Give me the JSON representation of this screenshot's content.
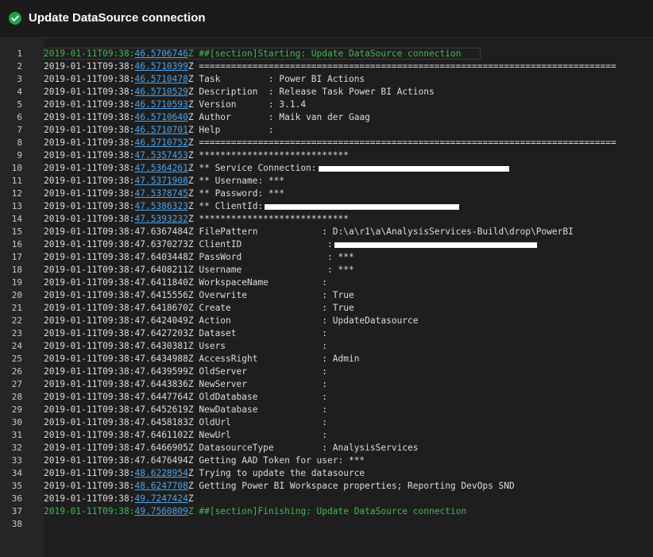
{
  "header": {
    "title": "Update DataSource connection",
    "status_icon": "check-circle-icon",
    "status_color": "#1ea446"
  },
  "log": {
    "lines": [
      {
        "n": "1",
        "date": "2019-01-11T09:38:",
        "sec": "46.5706746",
        "z": "Z",
        "msg": " ##[section]Starting: Update DataSource connection",
        "link": true,
        "section": true
      },
      {
        "n": "2",
        "date": "2019-01-11T09:38:",
        "sec": "46.5710399",
        "z": "Z",
        "msg": " ==============================================================================",
        "link": true
      },
      {
        "n": "3",
        "date": "2019-01-11T09:38:",
        "sec": "46.5710478",
        "z": "Z",
        "msg": " Task         : Power BI Actions",
        "link": true
      },
      {
        "n": "4",
        "date": "2019-01-11T09:38:",
        "sec": "46.5710529",
        "z": "Z",
        "msg": " Description  : Release Task Power BI Actions",
        "link": true
      },
      {
        "n": "5",
        "date": "2019-01-11T09:38:",
        "sec": "46.5710593",
        "z": "Z",
        "msg": " Version      : 3.1.4",
        "link": true
      },
      {
        "n": "6",
        "date": "2019-01-11T09:38:",
        "sec": "46.5710640",
        "z": "Z",
        "msg": " Author       : Maik van der Gaag",
        "link": true
      },
      {
        "n": "7",
        "date": "2019-01-11T09:38:",
        "sec": "46.5710701",
        "z": "Z",
        "msg": " Help         :",
        "link": true
      },
      {
        "n": "8",
        "date": "2019-01-11T09:38:",
        "sec": "46.5710752",
        "z": "Z",
        "msg": " ==============================================================================",
        "link": true
      },
      {
        "n": "9",
        "date": "2019-01-11T09:38:",
        "sec": "47.5357453",
        "z": "Z",
        "msg": " ****************************",
        "link": true
      },
      {
        "n": "10",
        "date": "2019-01-11T09:38:",
        "sec": "47.5364261",
        "z": "Z",
        "msg": " ** Service Connection:",
        "link": true,
        "redact": 240
      },
      {
        "n": "11",
        "date": "2019-01-11T09:38:",
        "sec": "47.5371908",
        "z": "Z",
        "msg": " ** Username: ***",
        "link": true
      },
      {
        "n": "12",
        "date": "2019-01-11T09:38:",
        "sec": "47.5378745",
        "z": "Z",
        "msg": " ** Password: ***",
        "link": true
      },
      {
        "n": "13",
        "date": "2019-01-11T09:38:",
        "sec": "47.5386323",
        "z": "Z",
        "msg": " ** ClientId:",
        "link": true,
        "redact": 245
      },
      {
        "n": "14",
        "date": "2019-01-11T09:38:",
        "sec": "47.5393232",
        "z": "Z",
        "msg": " ****************************",
        "link": true
      },
      {
        "n": "15",
        "date": "2019-01-11T09:38:",
        "sec": "47.6367484",
        "z": "Z",
        "msg": " FilePattern            : D:\\a\\r1\\a\\AnalysisServices-Build\\drop\\PowerBI",
        "link": false
      },
      {
        "n": "16",
        "date": "2019-01-11T09:38:",
        "sec": "47.6370273",
        "z": "Z",
        "msg": " ClientID                :",
        "link": false,
        "redact": 255
      },
      {
        "n": "17",
        "date": "2019-01-11T09:38:",
        "sec": "47.6403448",
        "z": "Z",
        "msg": " PassWord                : ***",
        "link": false
      },
      {
        "n": "18",
        "date": "2019-01-11T09:38:",
        "sec": "47.6408211",
        "z": "Z",
        "msg": " Username                : ***",
        "link": false
      },
      {
        "n": "19",
        "date": "2019-01-11T09:38:",
        "sec": "47.6411840",
        "z": "Z",
        "msg": " WorkspaceName          :",
        "link": false
      },
      {
        "n": "20",
        "date": "2019-01-11T09:38:",
        "sec": "47.6415556",
        "z": "Z",
        "msg": " Overwrite              : True",
        "link": false
      },
      {
        "n": "21",
        "date": "2019-01-11T09:38:",
        "sec": "47.6418670",
        "z": "Z",
        "msg": " Create                 : True",
        "link": false
      },
      {
        "n": "22",
        "date": "2019-01-11T09:38:",
        "sec": "47.6424049",
        "z": "Z",
        "msg": " Action                 : UpdateDatasource",
        "link": false
      },
      {
        "n": "23",
        "date": "2019-01-11T09:38:",
        "sec": "47.6427203",
        "z": "Z",
        "msg": " Dataset                :",
        "link": false
      },
      {
        "n": "24",
        "date": "2019-01-11T09:38:",
        "sec": "47.6430381",
        "z": "Z",
        "msg": " Users                  :",
        "link": false
      },
      {
        "n": "25",
        "date": "2019-01-11T09:38:",
        "sec": "47.6434988",
        "z": "Z",
        "msg": " AccessRight            : Admin",
        "link": false
      },
      {
        "n": "26",
        "date": "2019-01-11T09:38:",
        "sec": "47.6439599",
        "z": "Z",
        "msg": " OldServer              :",
        "link": false
      },
      {
        "n": "27",
        "date": "2019-01-11T09:38:",
        "sec": "47.6443836",
        "z": "Z",
        "msg": " NewServer              :",
        "link": false
      },
      {
        "n": "28",
        "date": "2019-01-11T09:38:",
        "sec": "47.6447764",
        "z": "Z",
        "msg": " OldDatabase            :",
        "link": false
      },
      {
        "n": "29",
        "date": "2019-01-11T09:38:",
        "sec": "47.6452619",
        "z": "Z",
        "msg": " NewDatabase            :",
        "link": false
      },
      {
        "n": "30",
        "date": "2019-01-11T09:38:",
        "sec": "47.6458183",
        "z": "Z",
        "msg": " OldUrl                 :",
        "link": false
      },
      {
        "n": "31",
        "date": "2019-01-11T09:38:",
        "sec": "47.6461102",
        "z": "Z",
        "msg": " NewUrl                 :",
        "link": false
      },
      {
        "n": "32",
        "date": "2019-01-11T09:38:",
        "sec": "47.6466905",
        "z": "Z",
        "msg": " DatasourceType         : AnalysisServices",
        "link": false
      },
      {
        "n": "33",
        "date": "2019-01-11T09:38:",
        "sec": "47.6476494",
        "z": "Z",
        "msg": " Getting AAD Token for user: ***",
        "link": false
      },
      {
        "n": "34",
        "date": "2019-01-11T09:38:",
        "sec": "48.6228954",
        "z": "Z",
        "msg": " Trying to update the datasource",
        "link": true
      },
      {
        "n": "35",
        "date": "2019-01-11T09:38:",
        "sec": "48.6247708",
        "z": "Z",
        "msg": " Getting Power BI Workspace properties; Reporting DevOps SND",
        "link": true
      },
      {
        "n": "36",
        "date": "2019-01-11T09:38:",
        "sec": "49.7247424",
        "z": "Z",
        "msg": "",
        "link": true
      },
      {
        "n": "37",
        "date": "2019-01-11T09:38:",
        "sec": "49.7560809",
        "z": "Z",
        "msg": " ##[section]Finishing: Update DataSource connection",
        "link": true,
        "section": true
      },
      {
        "n": "38",
        "date": "",
        "sec": "",
        "z": "",
        "msg": "",
        "link": false
      }
    ]
  }
}
